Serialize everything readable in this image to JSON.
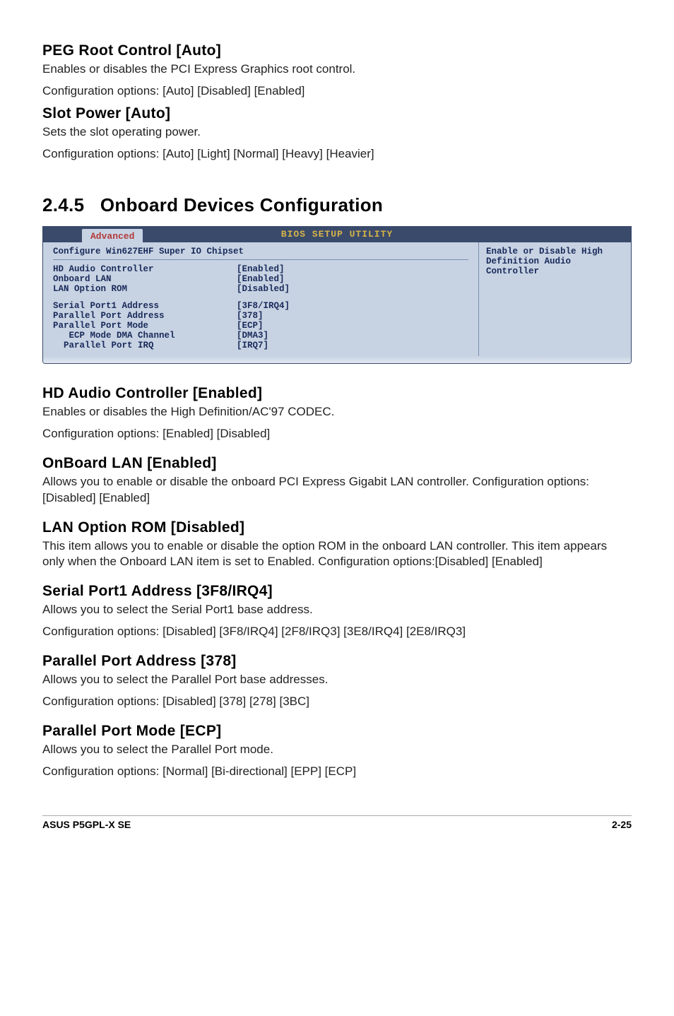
{
  "s1": {
    "title": "PEG Root Control [Auto]",
    "l1": "Enables or disables the PCI Express Graphics root control.",
    "l2": "Configuration options: [Auto] [Disabled] [Enabled]"
  },
  "s2": {
    "title": "Slot Power [Auto]",
    "l1": "Sets the slot operating power.",
    "l2": "Configuration options: [Auto] [Light] [Normal] [Heavy] [Heavier]"
  },
  "major": {
    "num": "2.4.5",
    "title": "Onboard Devices Configuration"
  },
  "bios": {
    "utility": "BIOS SETUP UTILITY",
    "tab": "Advanced",
    "header": "Configure Win627EHF Super IO Chipset",
    "help": "Enable or Disable High Definition Audio Controller",
    "rows": [
      {
        "label": "HD Audio Controller",
        "value": "[Enabled]"
      },
      {
        "label": "Onboard LAN",
        "value": "[Enabled]"
      },
      {
        "label": "LAN Option ROM",
        "value": "[Disabled]"
      }
    ],
    "rows2": [
      {
        "label": "Serial Port1 Address",
        "value": "[3F8/IRQ4]"
      },
      {
        "label": "Parallel Port Address",
        "value": "[378]"
      },
      {
        "label": "Parallel Port Mode",
        "value": "[ECP]"
      },
      {
        "label": "   ECP Mode DMA Channel",
        "value": "[DMA3]"
      },
      {
        "label": "  Parallel Port IRQ",
        "value": "[IRQ7]"
      }
    ]
  },
  "s3": {
    "title": "HD Audio Controller [Enabled]",
    "l1": "Enables or disables the High Definition/AC'97 CODEC.",
    "l2": "Configuration options: [Enabled] [Disabled]"
  },
  "s4": {
    "title": "OnBoard LAN [Enabled]",
    "l1": "Allows you to enable or disable the onboard PCI Express Gigabit LAN controller.  Configuration options: [Disabled] [Enabled]"
  },
  "s5": {
    "title": "LAN Option ROM [Disabled]",
    "l1": "This item allows you to enable or disable the option ROM in the onboard LAN controller. This item appears only when the Onboard LAN item is set to Enabled. Configuration options:[Disabled] [Enabled]"
  },
  "s6": {
    "title": "Serial Port1 Address [3F8/IRQ4]",
    "l1": "Allows you to select the Serial Port1 base address.",
    "l2": "Configuration options: [Disabled] [3F8/IRQ4] [2F8/IRQ3] [3E8/IRQ4] [2E8/IRQ3]"
  },
  "s7": {
    "title": "Parallel Port Address [378]",
    "l1": "Allows you to select the Parallel Port base addresses.",
    "l2": "Configuration options: [Disabled] [378] [278] [3BC]"
  },
  "s8": {
    "title": "Parallel Port Mode [ECP]",
    "l1": "Allows you to select the Parallel Port  mode.",
    "l2": "Configuration options: [Normal] [Bi-directional] [EPP] [ECP]"
  },
  "footer": {
    "left": "ASUS P5GPL-X SE",
    "right": "2-25"
  }
}
